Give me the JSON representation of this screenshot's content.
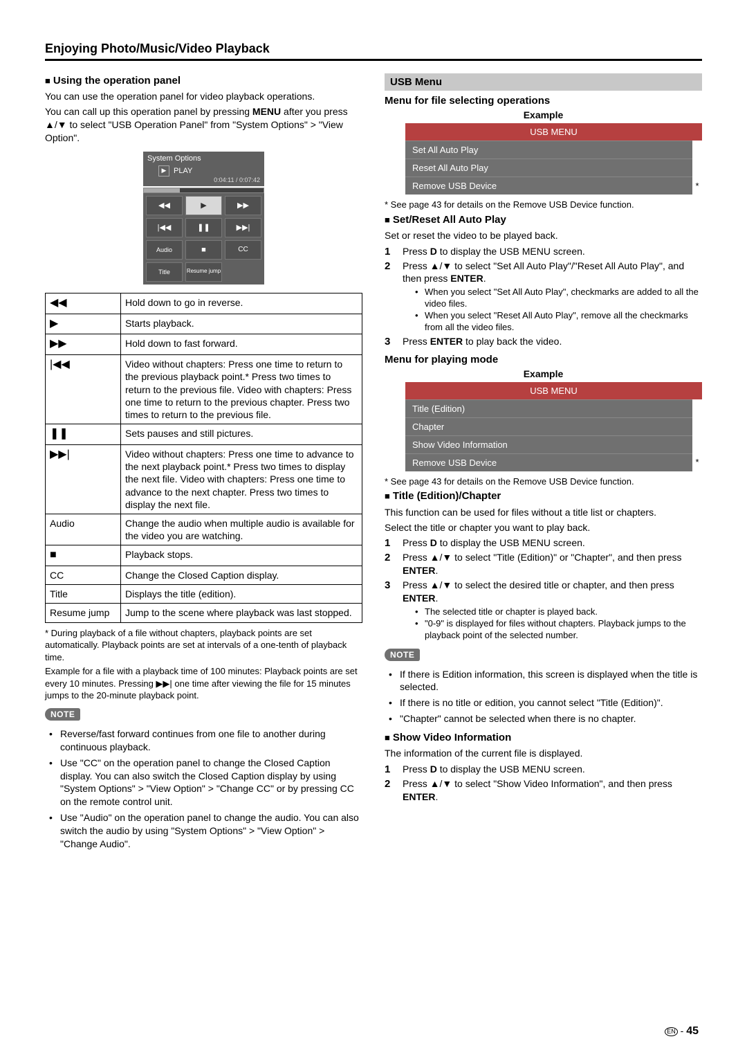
{
  "page_title": "Enjoying Photo/Music/Video Playback",
  "left": {
    "h1a": "Using the operation panel",
    "p1": "You can use the operation panel for video playback operations.",
    "p2a": "You can call up this operation panel by pressing ",
    "p2b": "MENU",
    "p2c": " after you press ▲/▼ to select \"USB Operation Panel\" from \"System Options\" > \"View Option\".",
    "panel": {
      "top": "System Options",
      "play_label": "PLAY",
      "time": "0:04:11 / 0:07:42",
      "grid": [
        "◀◀",
        "▶",
        "▶▶",
        "|◀◀",
        "❚❚",
        "▶▶|",
        "Audio",
        "■",
        "CC",
        "Title",
        "Resume jump",
        ""
      ]
    },
    "table": [
      {
        "icon": "◀◀",
        "desc": "Hold down to go in reverse."
      },
      {
        "icon": "▶",
        "desc": "Starts playback."
      },
      {
        "icon": "▶▶",
        "desc": "Hold down to fast forward."
      },
      {
        "icon": "|◀◀",
        "desc": "Video without chapters: Press one time to return to the previous playback point.* Press two times to return to the previous file. Video with chapters: Press one time to return to the previous chapter. Press two times to return to the previous file."
      },
      {
        "icon": "❚❚",
        "desc": "Sets pauses and still pictures."
      },
      {
        "icon": "▶▶|",
        "desc": "Video without chapters: Press one time to advance to the next playback point.* Press two times to display the next file. Video with chapters: Press one time to advance to the next chapter. Press two times to display the next file."
      },
      {
        "icon": "Audio",
        "desc": "Change the audio when multiple audio is available for the video you are watching."
      },
      {
        "icon": "■",
        "desc": "Playback stops."
      },
      {
        "icon": "CC",
        "desc": "Change the Closed Caption display."
      },
      {
        "icon": "Title",
        "desc": "Displays the title (edition)."
      },
      {
        "icon": "Resume jump",
        "desc": "Jump to the scene where playback was last stopped."
      }
    ],
    "starnote": "* During playback of a file without chapters, playback points are set automatically. Playback points are set at intervals of a one-tenth of playback time.",
    "example_p": "Example for a file with a playback time of 100 minutes: Playback points are set every 10 minutes. Pressing ▶▶| one time after viewing the file for 15 minutes jumps to the 20-minute playback point.",
    "note_label": "NOTE",
    "notes": [
      "Reverse/fast forward continues from one file to another during continuous playback.",
      "Use \"CC\" on the operation panel to change the Closed Caption display. You can also switch the Closed Caption display by using \"System Options\" > \"View Option\" > \"Change CC\" or by pressing CC on the remote control unit.",
      "Use \"Audio\" on the operation panel to change the audio. You can also switch the audio by using \"System Options\" > \"View Option\" > \"Change Audio\"."
    ]
  },
  "right": {
    "usb_header": "USB Menu",
    "subhead1": "Menu for file selecting operations",
    "example": "Example",
    "menu1_title": "USB MENU",
    "menu1_items": [
      "Set All Auto Play",
      "Reset All Auto Play",
      "Remove USB Device"
    ],
    "starline": "* See page 43 for details on the Remove USB Device function.",
    "h2": "Set/Reset All Auto Play",
    "h2_p": "Set or reset the video to be played back.",
    "h2_steps": {
      "s1a": "Press ",
      "s1b": "D",
      "s1c": " to display the USB MENU screen.",
      "s2a": "Press ▲/▼ to select \"Set All Auto Play\"/\"Reset All Auto Play\", and then press ",
      "s2b": "ENTER",
      "s2c": ".",
      "s3a": "Press ",
      "s3b": "ENTER",
      "s3c": " to play back the video."
    },
    "h2_bul": [
      "When you select \"Set All Auto Play\", checkmarks are added to all the video files.",
      "When you select \"Reset All Auto Play\", remove all the checkmarks from all the video files."
    ],
    "subhead2": "Menu for playing mode",
    "menu2_title": "USB MENU",
    "menu2_items": [
      "Title (Edition)",
      "Chapter",
      "Show Video Information",
      "Remove USB Device"
    ],
    "h3": "Title (Edition)/Chapter",
    "h3_p1": "This function can be used for files without a title list or chapters.",
    "h3_p2": "Select the title or chapter you want to play back.",
    "h3_steps": {
      "s1a": "Press ",
      "s1b": "D",
      "s1c": " to display the USB MENU screen.",
      "s2a": "Press ▲/▼ to select \"Title (Edition)\" or \"Chapter\", and then press ",
      "s2b": "ENTER",
      "s2c": ".",
      "s3a": "Press ▲/▼ to select the desired title or chapter, and then press ",
      "s3b": "ENTER",
      "s3c": "."
    },
    "h3_bul": [
      "The selected title or chapter is played back.",
      "\"0-9\" is displayed for files without chapters. Playback jumps to the playback point of the selected number."
    ],
    "h3_notes": [
      "If there is Edition information, this screen is displayed when the title is selected.",
      "If there is no title or edition, you cannot select \"Title (Edition)\".",
      "\"Chapter\" cannot be selected when there is no chapter."
    ],
    "h4": "Show Video Information",
    "h4_p": "The information of the current file is displayed.",
    "h4_steps": {
      "s1a": "Press ",
      "s1b": "D",
      "s1c": " to display the USB MENU screen.",
      "s2a": "Press ▲/▼ to select \"Show Video Information\", and then press ",
      "s2b": "ENTER",
      "s2c": "."
    }
  },
  "page_number": "45",
  "en_label": "EN"
}
